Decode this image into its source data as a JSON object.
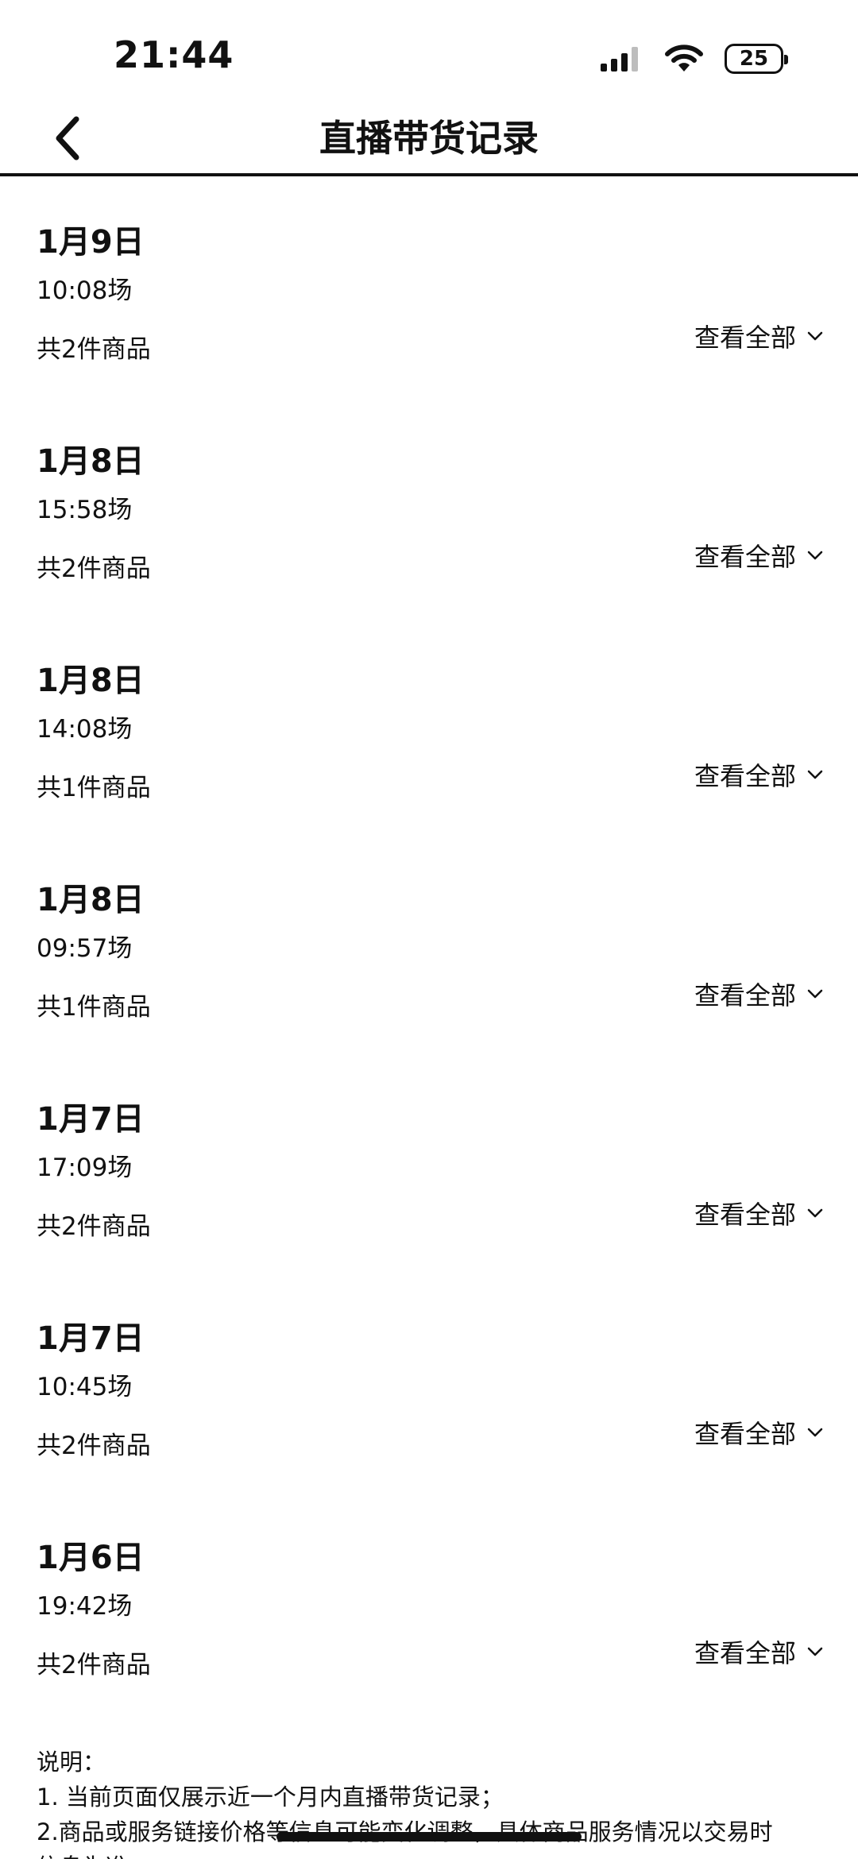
{
  "status_bar": {
    "time": "21:44",
    "battery_level": "25",
    "icons": [
      "signal-icon",
      "wifi-icon",
      "battery-icon"
    ]
  },
  "nav": {
    "back_icon": "chevron-left-icon",
    "title": "直播带货记录"
  },
  "records": [
    {
      "date": "1月9日",
      "session": "10:08场",
      "count": "共2件商品",
      "view_all": "查看全部"
    },
    {
      "date": "1月8日",
      "session": "15:58场",
      "count": "共2件商品",
      "view_all": "查看全部"
    },
    {
      "date": "1月8日",
      "session": "14:08场",
      "count": "共1件商品",
      "view_all": "查看全部"
    },
    {
      "date": "1月8日",
      "session": "09:57场",
      "count": "共1件商品",
      "view_all": "查看全部"
    },
    {
      "date": "1月7日",
      "session": "17:09场",
      "count": "共2件商品",
      "view_all": "查看全部"
    },
    {
      "date": "1月7日",
      "session": "10:45场",
      "count": "共2件商品",
      "view_all": "查看全部"
    },
    {
      "date": "1月6日",
      "session": "19:42场",
      "count": "共2件商品",
      "view_all": "查看全部"
    }
  ],
  "notes": {
    "heading": "说明：",
    "line1": "1. 当前页面仅展示近一个月内直播带货记录；",
    "line2": "2.商品或服务链接价格等信息可能变化调整，具体商品服务情况以交易时",
    "line3": "信息为准"
  },
  "colors": {
    "text": "#111111",
    "background": "#ffffff"
  }
}
